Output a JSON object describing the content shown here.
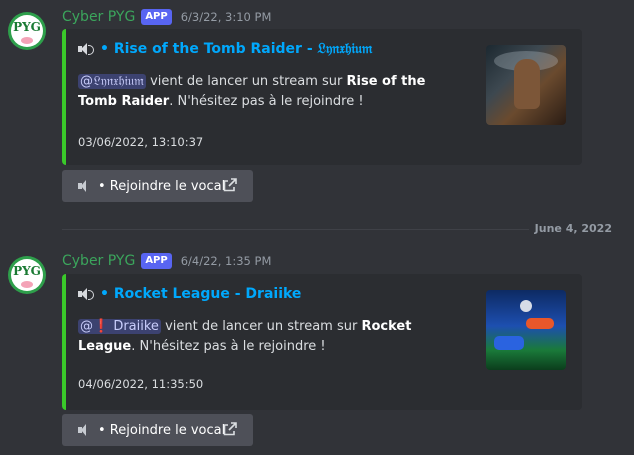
{
  "messages": [
    {
      "author": "Cyber PYG",
      "badge": "APP",
      "timestamp": "6/3/22, 3:10 PM",
      "avatar_text": "PYG",
      "embed": {
        "title": "• Rise of the Tomb Raider - 𝔏𝔶𝔫𝔵𝔥𝔦𝔲𝔪",
        "mention": "@𝔏𝔶𝔫𝔵𝔥𝔦𝔲𝔪",
        "mention_excl": "",
        "desc_pre": " vient de lancer un stream sur ",
        "game": "Rise of the Tomb Raider",
        "desc_post": ". N'hésitez pas à le rejoindre !",
        "footer": "03/06/2022, 13:10:37",
        "accent_color": "#3ac92a"
      },
      "button_label": "• Rejoindre le vocal"
    },
    {
      "author": "Cyber PYG",
      "badge": "APP",
      "timestamp": "6/4/22, 1:35 PM",
      "avatar_text": "PYG",
      "embed": {
        "title": "• Rocket League - Draiike",
        "mention": " Draiike",
        "mention_excl": "❗",
        "desc_pre": " vient de lancer un stream sur ",
        "game": "Rocket League",
        "desc_post": ". N'hésitez pas à le rejoindre !",
        "footer": "04/06/2022, 11:35:50",
        "accent_color": "#3ac92a"
      },
      "button_label": "• Rejoindre le vocal"
    }
  ],
  "date_divider": "June 4, 2022",
  "icons": {
    "speaker": "speaker-icon",
    "external_link": "external-link-icon"
  },
  "colors": {
    "author": "#3ba55c",
    "badge": "#5865f2",
    "link": "#00a8fc",
    "background": "#313338",
    "embed_background": "#2b2d31"
  }
}
